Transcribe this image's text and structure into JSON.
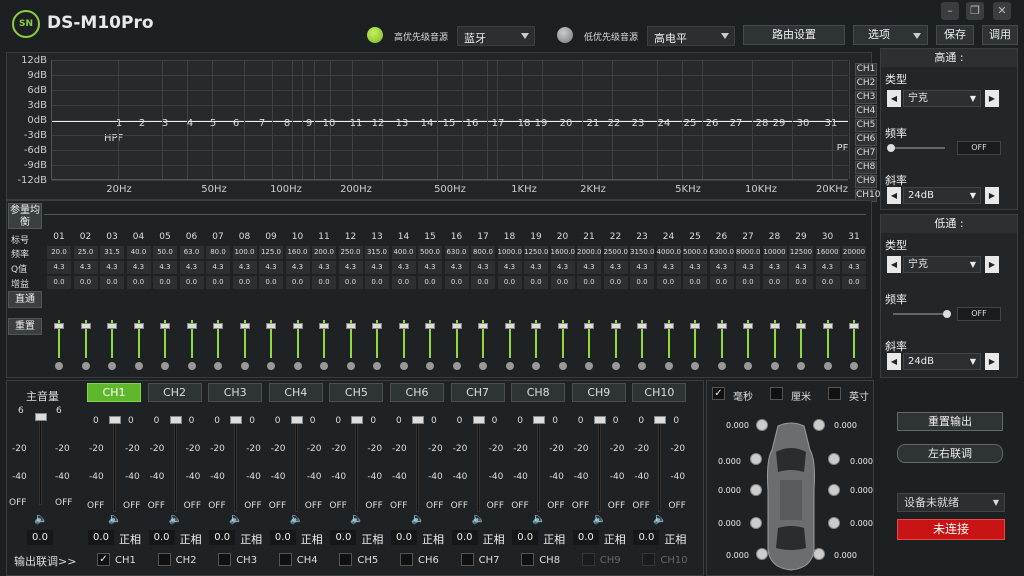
{
  "app": {
    "title": "DS-M10Pro",
    "logo": "SN"
  },
  "header": {
    "high_source_label": "高优先级音源",
    "high_source_value": "蓝牙",
    "low_source_label": "低优先级音源",
    "low_source_value": "高电平",
    "route_btn": "路由设置",
    "options_btn": "选项",
    "save_btn": "保存",
    "load_btn": "调用"
  },
  "colors": {
    "accent": "#8ccf3a",
    "active_tab": "#5fb82c",
    "red": "#c81414"
  },
  "graph": {
    "db_labels": [
      "12dB",
      "9dB",
      "6dB",
      "3dB",
      "0dB",
      "-3dB",
      "-6dB",
      "-9dB",
      "-12dB"
    ],
    "hpf_label": "HPF",
    "lpf_label": "LPF",
    "freq_ticks": [
      "20Hz",
      "50Hz",
      "100Hz",
      "200Hz",
      "500Hz",
      "1KHz",
      "2KHz",
      "5KHz",
      "10KHz",
      "20KHz"
    ],
    "channels": [
      "CH1",
      "CH2",
      "CH3",
      "CH4",
      "CH5",
      "CH6",
      "CH7",
      "CH8",
      "CH9",
      "CH10"
    ]
  },
  "eq": {
    "param_eq_btn": "参量均衡",
    "bypass_btn": "直通",
    "reset_btn": "重置",
    "row_labels": [
      "标号",
      "频率",
      "Q值",
      "增益"
    ],
    "bands": [
      {
        "n": "01",
        "f": "20.0"
      },
      {
        "n": "02",
        "f": "25.0"
      },
      {
        "n": "03",
        "f": "31.5"
      },
      {
        "n": "04",
        "f": "40.0"
      },
      {
        "n": "05",
        "f": "50.0"
      },
      {
        "n": "06",
        "f": "63.0"
      },
      {
        "n": "07",
        "f": "80.0"
      },
      {
        "n": "08",
        "f": "100.0"
      },
      {
        "n": "09",
        "f": "125.0"
      },
      {
        "n": "10",
        "f": "160.0"
      },
      {
        "n": "11",
        "f": "200.0"
      },
      {
        "n": "12",
        "f": "250.0"
      },
      {
        "n": "13",
        "f": "315.0"
      },
      {
        "n": "14",
        "f": "400.0"
      },
      {
        "n": "15",
        "f": "500.0"
      },
      {
        "n": "16",
        "f": "630.0"
      },
      {
        "n": "17",
        "f": "800.0"
      },
      {
        "n": "18",
        "f": "1000.0"
      },
      {
        "n": "19",
        "f": "1250.0"
      },
      {
        "n": "20",
        "f": "1600.0"
      },
      {
        "n": "21",
        "f": "2000.0"
      },
      {
        "n": "22",
        "f": "2500.0"
      },
      {
        "n": "23",
        "f": "3150.0"
      },
      {
        "n": "24",
        "f": "4000.0"
      },
      {
        "n": "25",
        "f": "5000.0"
      },
      {
        "n": "26",
        "f": "6300.0"
      },
      {
        "n": "27",
        "f": "8000.0"
      },
      {
        "n": "28",
        "f": "10000"
      },
      {
        "n": "29",
        "f": "12500"
      },
      {
        "n": "30",
        "f": "16000"
      },
      {
        "n": "31",
        "f": "20000"
      }
    ],
    "q_value": "4.3",
    "gain_value": "0.0"
  },
  "highpass": {
    "title": "高通 :",
    "type_label": "类型",
    "type_value": "宁克",
    "freq_label": "频率",
    "freq_value": "OFF",
    "slope_label": "斜率",
    "slope_value": "24dB"
  },
  "lowpass": {
    "title": "低通 :",
    "type_label": "类型",
    "type_value": "宁克",
    "freq_label": "频率",
    "freq_value": "OFF",
    "slope_label": "斜率",
    "slope_value": "24dB"
  },
  "master": {
    "label": "主音量",
    "top": "6",
    "m20": "-20",
    "m40": "-40",
    "off": "OFF",
    "value": "0.0",
    "link_label": "输出联调>>"
  },
  "channels": {
    "tabs": [
      "CH1",
      "CH2",
      "CH3",
      "CH4",
      "CH5",
      "CH6",
      "CH7",
      "CH8",
      "CH9",
      "CH10"
    ],
    "scale": {
      "top": "0",
      "m20": "-20",
      "m40": "-40",
      "off": "OFF"
    },
    "value": "0.0",
    "phase": "正相",
    "link": [
      "CH1",
      "CH2",
      "CH3",
      "CH4",
      "CH5",
      "CH6",
      "CH7",
      "CH8",
      "CH9",
      "CH10"
    ]
  },
  "delay": {
    "units": [
      "毫秒",
      "厘米",
      "英寸"
    ],
    "values": [
      "0.000",
      "0.000",
      "0.000",
      "0.000",
      "0.000",
      "0.000",
      "0.000",
      "0.000",
      "0.000",
      "0.000"
    ]
  },
  "right": {
    "reset_output": "重置输出",
    "lr_link": "左右联调",
    "device_status": "设备未就绪",
    "connect": "未连接"
  }
}
